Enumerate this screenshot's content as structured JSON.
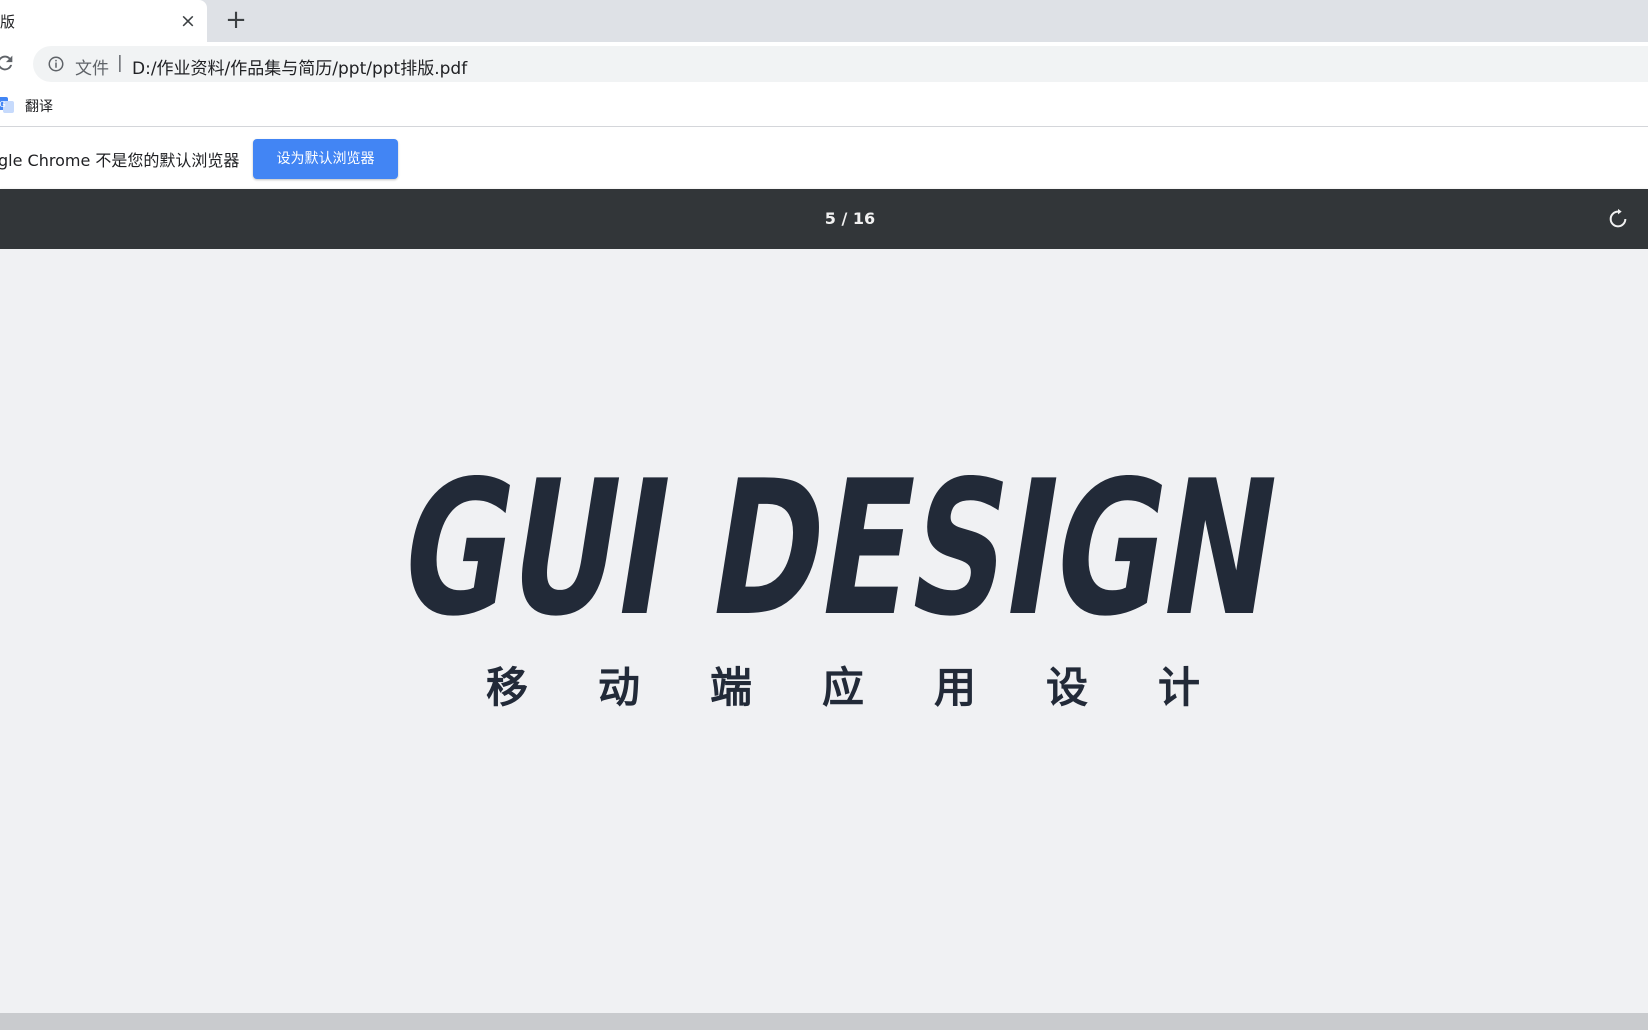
{
  "tab": {
    "title": "版",
    "close": "×",
    "new_tab": "+"
  },
  "toolbar": {
    "scheme": "文件",
    "separator": "|",
    "url": "D:/作业资料/作品集与简历/ppt/ppt排版.pdf"
  },
  "bookmarks": [
    {
      "label": "翻译",
      "icon": "google-translate-icon"
    }
  ],
  "infobar": {
    "text": "gle Chrome 不是您的默认浏览器",
    "button": "设为默认浏览器"
  },
  "pdf": {
    "page_indicator": "5 / 16"
  },
  "document": {
    "logo_text": "GUI DESIGN",
    "subtitle": "移动端应用设计"
  },
  "colors": {
    "accent": "#4285f4",
    "pdf_toolbar": "#323639",
    "logo": "#222a38",
    "viewer_bg": "#f0f1f3"
  }
}
